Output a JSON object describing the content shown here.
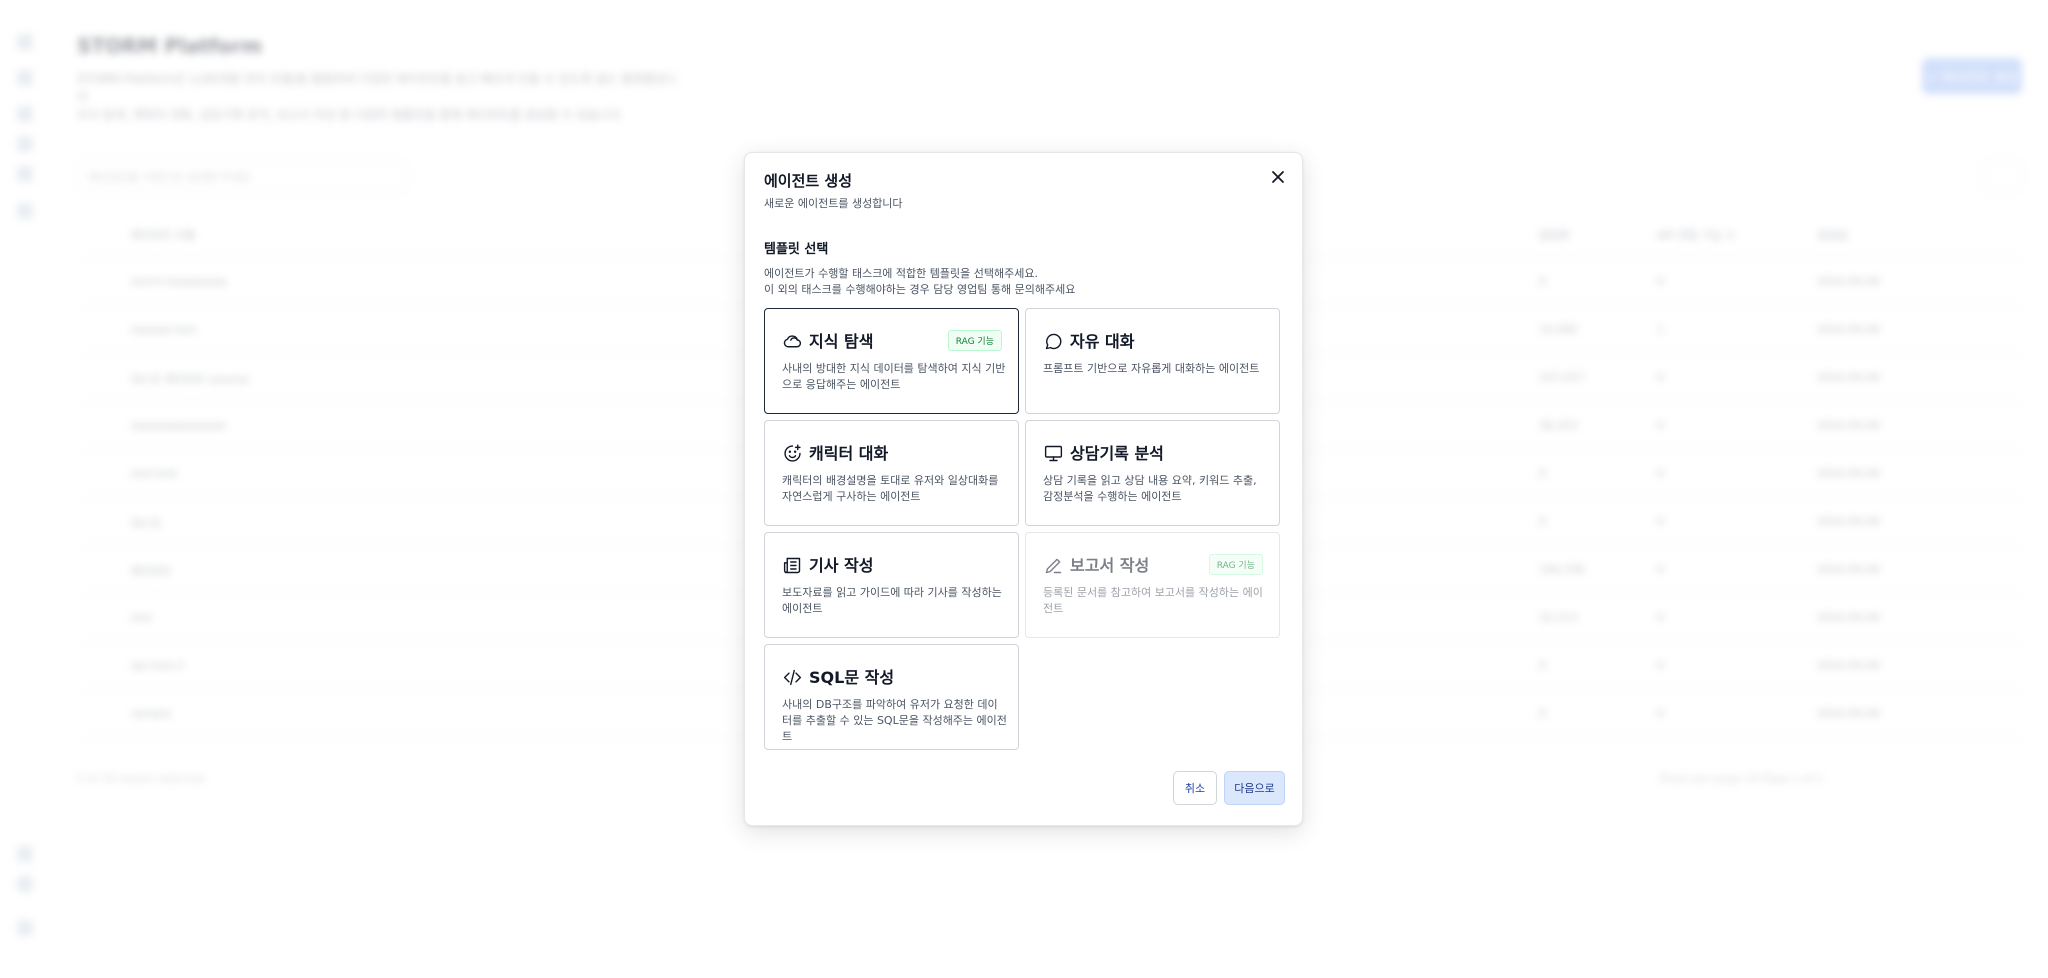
{
  "background": {
    "app_title": "STORM Platform",
    "description_line1": "STORM Platform은 LLM(대형 언어 모델)을 활용하여 다양한 에이전트를 쉽고 빠르게 만들 수 있도록 돕는 플랫폼입니다",
    "description_line2": "지식 탐색, 캐릭터 대화, 상담기록 분석, 보고서 작성 등 다양한 템플릿을 통해 에이전트를 생성할 수 있습니다",
    "create_button": "+ 에이전트 생성",
    "search_placeholder": "에이전트를 키워드로 검색해 주세요",
    "table_header": [
      "에이전트 이름",
      "",
      "알림톡",
      "API 연동 기능 수",
      "생성일"
    ],
    "rows": [
      [
        "storm-kaaaaaaaa",
        "0",
        "0",
        "2024.00.00"
      ],
      [
        "kaaaaa-test",
        "14,000",
        "1",
        "2024.00.00"
      ],
      [
        "테스트 에이전트 tutorial",
        "107,037",
        "0",
        "2024.00.00"
      ],
      [
        "aaaaaaaaaaaaaa",
        "38,203",
        "0",
        "2024.00.00"
      ],
      [
        "test-test",
        "0",
        "0",
        "2024.00.00"
      ],
      [
        "테스트",
        "0",
        "0",
        "2024.00.00"
      ],
      [
        "에이전트",
        "194,336",
        "0",
        "2024.00.00"
      ],
      [
        "test",
        "22,213",
        "0",
        "2024.00.00"
      ],
      [
        "api-test-2",
        "0",
        "0",
        "2024.00.00"
      ],
      [
        "sample",
        "0",
        "0",
        "2024.00.00"
      ]
    ],
    "footer_text": "0 of 10 row(s) selected.",
    "pager_text": "Rows per page   10        Page 1 of 1"
  },
  "modal": {
    "title": "에이전트 생성",
    "subtitle": "새로운 에이전트를 생성합니다",
    "section_title": "템플릿 선택",
    "section_desc_line1": "에이전트가 수행할 태스크에 적합한 템플릿을 선택해주세요.",
    "section_desc_line2": "이 외의 태스크를 수행해야하는 경우 담당 영업팀 통해 문의해주세요",
    "templates": [
      {
        "title": "지식 탐색",
        "icon": "cloud-icon",
        "badge": "RAG 기능",
        "description": "사내의 방대한 지식 데이터를 탐색하여 지식 기반으로 응답해주는 에이전트",
        "state": "selected"
      },
      {
        "title": "자유 대화",
        "icon": "chat-bubble-icon",
        "badge": "",
        "description": "프롬프트 기반으로 자유롭게 대화하는 에이전트",
        "state": "default"
      },
      {
        "title": "캐릭터 대화",
        "icon": "smile-sparkle-icon",
        "badge": "",
        "description": "캐릭터의 배경설명을 토대로 유저와 일상대화를 자연스럽게 구사하는 에이전트",
        "state": "default"
      },
      {
        "title": "상담기록 분석",
        "icon": "monitor-icon",
        "badge": "",
        "description": "상담 기록을 읽고 상담 내용 요약, 키워드 추출, 감정분석을 수행하는 에이전트",
        "state": "default"
      },
      {
        "title": "기사 작성",
        "icon": "newspaper-icon",
        "badge": "",
        "description": "보도자료를 읽고 가이드에 따라 기사를 작성하는 에이전트",
        "state": "default"
      },
      {
        "title": "보고서 작성",
        "icon": "pencil-icon",
        "badge": "RAG 기능",
        "description": "등록된 문서를 참고하여 보고서를 작성하는 에이전트",
        "state": "disabled"
      },
      {
        "title": "SQL문 작성",
        "icon": "code-icon",
        "badge": "",
        "description": "사내의 DB구조를 파악하여 유저가 요청한 데이터를 추출할 수 있는 SQL문을 작성해주는 에이전트",
        "state": "default"
      }
    ],
    "cancel_label": "취소",
    "next_label": "다음으로"
  }
}
